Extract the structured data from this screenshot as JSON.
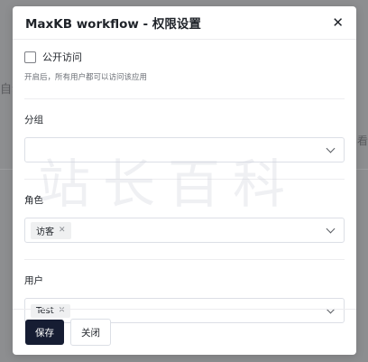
{
  "background": {
    "left_text": "自动",
    "right_text": "看"
  },
  "modal": {
    "title": "MaxKB workflow - 权限设置",
    "public_access": {
      "label": "公开访问",
      "checked": false,
      "hint": "开启后，所有用户都可以访问该应用"
    },
    "group": {
      "label": "分组",
      "selected": []
    },
    "role": {
      "label": "角色",
      "selected": [
        "访客"
      ]
    },
    "user": {
      "label": "用户",
      "selected": [
        "Test"
      ]
    },
    "footer": {
      "save_label": "保存",
      "close_label": "关闭"
    }
  },
  "watermark_text": "站长百科",
  "colors": {
    "primary_button": "#161d33",
    "border": "#dcdfe6",
    "overlay": "#8d8e90"
  },
  "icons": {
    "close": "close-icon",
    "dropdown": "chevron-down-icon",
    "tag_remove": "tag-close-icon"
  }
}
